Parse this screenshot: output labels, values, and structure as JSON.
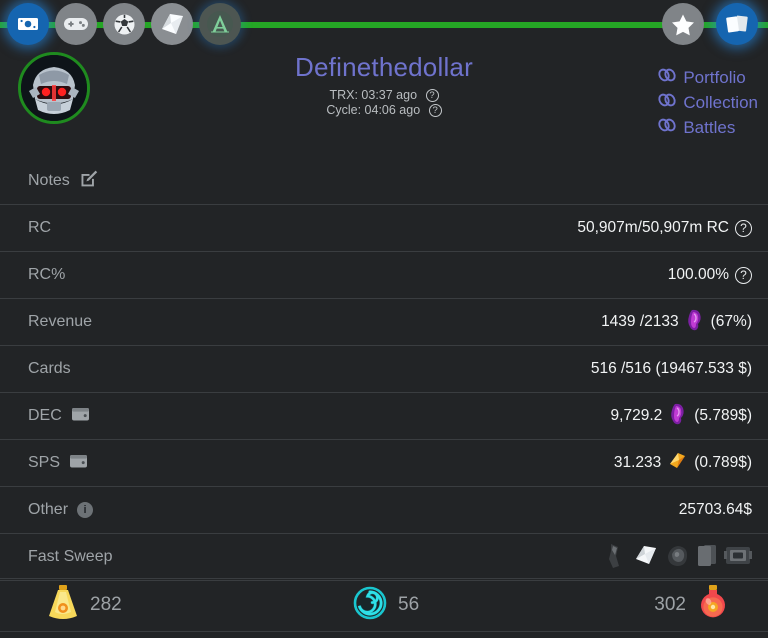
{
  "theme": {
    "bg": "#222426",
    "accent_link": "#6f73cd",
    "green_bar": "#25a625",
    "active_blue": "#1565b0",
    "label_gray": "#9fa4a8",
    "value_white": "#f2f4f5",
    "divider": "#3a3d40"
  },
  "topnav": {
    "items": [
      {
        "name": "money-icon",
        "icon": "cash",
        "state": "active"
      },
      {
        "name": "gamepad-icon",
        "icon": "gamepad",
        "state": "normal"
      },
      {
        "name": "soccer-ball-icon",
        "icon": "ball",
        "state": "normal"
      },
      {
        "name": "scroll-icon",
        "icon": "scroll",
        "state": "normal"
      },
      {
        "name": "archmage-a-icon",
        "icon": "letter-a",
        "state": "dim"
      }
    ],
    "right_items": [
      {
        "name": "star-icon",
        "icon": "star",
        "state": "normal"
      },
      {
        "name": "cards-icon",
        "icon": "cards",
        "state": "active"
      }
    ]
  },
  "header": {
    "avatar_alt": "robot-avatar",
    "title": "Definethedollar",
    "trx_label": "TRX: 03:37 ago",
    "cycle_label": "Cycle: 04:06 ago",
    "help_glyph": "?",
    "links": [
      {
        "label": "Portfolio",
        "icon": "chain-link-icon"
      },
      {
        "label": "Collection",
        "icon": "chain-link-icon"
      },
      {
        "label": "Battles",
        "icon": "chain-link-icon"
      }
    ]
  },
  "rows": [
    {
      "id": "notes",
      "label": "Notes",
      "label_icon": "edit-pencil-icon",
      "value": ""
    },
    {
      "id": "rc",
      "label": "RC",
      "value": "50,907m/50,907m RC",
      "help": "?"
    },
    {
      "id": "rc-percent",
      "label": "RC%",
      "value": "100.00%",
      "help": "?"
    },
    {
      "id": "revenue",
      "label": "Revenue",
      "value": "1439 /2133",
      "value_icon": "dec-token-icon",
      "value_suffix": "(67%)"
    },
    {
      "id": "cards",
      "label": "Cards",
      "value": "516 /516 (19467.533 $)"
    },
    {
      "id": "dec",
      "label": "DEC",
      "label_icon": "wallet-icon",
      "value": "9,729.2",
      "value_icon": "dec-token-icon",
      "value_suffix": "(5.789$)"
    },
    {
      "id": "sps",
      "label": "SPS",
      "label_icon": "wallet-icon",
      "value": "31.233",
      "value_icon": "sps-token-icon",
      "value_suffix": "(0.789$)"
    },
    {
      "id": "other",
      "label": "Other",
      "label_icon": "info-icon",
      "value": "25703.64$"
    },
    {
      "id": "fast-sweep",
      "label": "Fast Sweep",
      "value": "",
      "sweep_icons": [
        "ore-icon",
        "paper-scroll-icon",
        "rock-icon",
        "card-stack-icon",
        "machine-icon"
      ]
    }
  ],
  "bottom_bar": {
    "slots": [
      {
        "id": "gold-potion",
        "icon": "gold-potion-icon",
        "value": "282",
        "order": "icon-first"
      },
      {
        "id": "vortex",
        "icon": "teal-spiral-icon",
        "value": "56",
        "order": "icon-first"
      },
      {
        "id": "red-potion",
        "icon": "red-potion-icon",
        "value": "302",
        "order": "value-first"
      }
    ]
  }
}
